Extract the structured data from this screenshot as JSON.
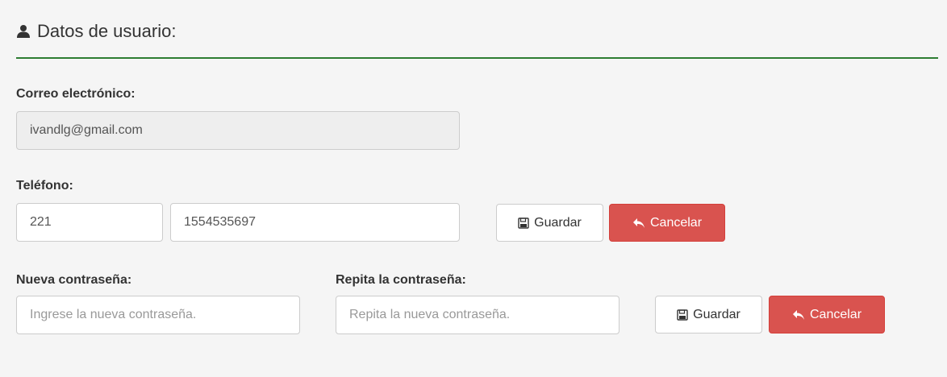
{
  "header": {
    "title": "Datos de usuario:",
    "icon": "user-icon"
  },
  "email": {
    "label": "Correo electrónico:",
    "value": "ivandlg@gmail.com"
  },
  "phone": {
    "label": "Teléfono:",
    "area_code": "221",
    "number": "1554535697",
    "save_label": "Guardar",
    "cancel_label": "Cancelar"
  },
  "password": {
    "new_label": "Nueva contraseña:",
    "new_placeholder": "Ingrese la nueva contraseña.",
    "repeat_label": "Repita la contraseña:",
    "repeat_placeholder": "Repita la nueva contraseña.",
    "save_label": "Guardar",
    "cancel_label": "Cancelar"
  },
  "colors": {
    "accent_line": "#2e7d32",
    "danger": "#d9534f"
  }
}
